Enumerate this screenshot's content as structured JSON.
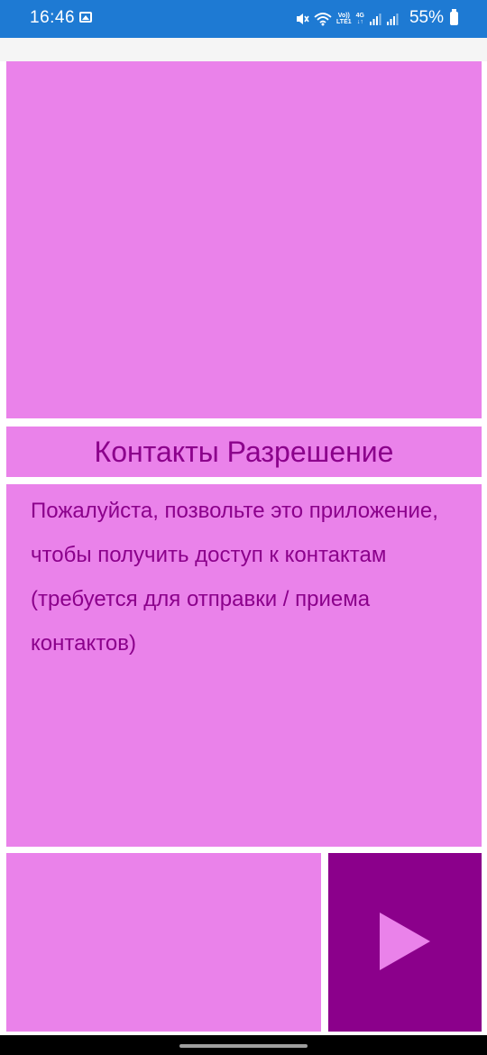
{
  "status_bar": {
    "time": "16:46",
    "volte_label": "Vo))",
    "lte_label": "LTE1",
    "network_label": "4G",
    "battery_percent": "55%",
    "background_color": "#1e7ad3"
  },
  "permission": {
    "title": "Контакты Разрешение",
    "message": "Пожалуйста, позвольте это приложение, чтобы получить доступ к контактам (требуется для отправки / приема контактов)"
  },
  "colors": {
    "panel": "#ea82ea",
    "accent": "#8b008b",
    "play_icon": "#ea82ea"
  },
  "icons": {
    "next": "play-icon"
  }
}
